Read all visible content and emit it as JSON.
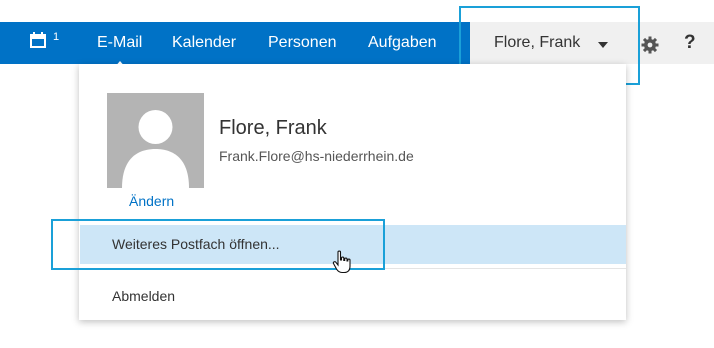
{
  "colors": {
    "brand_blue": "#0072c6",
    "highlight_row": "#cde6f7",
    "annotation_box": "#1aa0d8",
    "link": "#0072c6"
  },
  "topbar": {
    "calendar_icon": "calendar-icon",
    "calendar_badge": "1",
    "nav": [
      {
        "label": "E-Mail",
        "active": true
      },
      {
        "label": "Kalender"
      },
      {
        "label": "Personen"
      },
      {
        "label": "Aufgaben"
      }
    ],
    "user_label": "Flore, Frank",
    "settings_icon": "gear-icon",
    "help_label": "?"
  },
  "dropdown": {
    "name": "Flore, Frank",
    "email": "Frank.Flore@hs-niederrhein.de",
    "change_label": "Ändern",
    "items": [
      {
        "label": "Weiteres Postfach öffnen..."
      },
      {
        "label": "Abmelden"
      }
    ]
  }
}
